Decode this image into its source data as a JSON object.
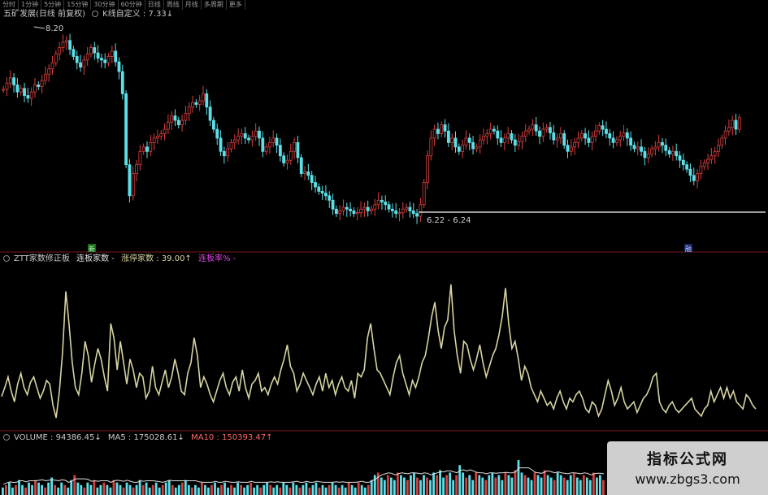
{
  "tabs": [
    "分时",
    "1分钟",
    "5分钟",
    "15分钟",
    "30分钟",
    "60分钟",
    "日线",
    "周线",
    "月线",
    "多周期",
    "更多"
  ],
  "main_header": {
    "title": "五矿发展(日线 前复权)",
    "indicator": "K线自定义 : 7.33↓"
  },
  "ztt_header": {
    "name": "ZTT家数修正板",
    "label1": "连板家数 -",
    "label2": "涨停家数 : 39.00↑",
    "label3": "连板率% -"
  },
  "vol_header": {
    "vol": "VOLUME : 94386.45↓",
    "ma5": "MA5 : 175028.61↓",
    "ma10": "MA10 : 150393.47↑"
  },
  "annotations": {
    "high_label": "8.20",
    "range_label": "6.22 - 6.24",
    "marker_left": "新",
    "marker_right": "融"
  },
  "watermark": {
    "title": "指标公式网",
    "url": "www.zbgs3.com"
  },
  "colors": {
    "up": "#d84040",
    "down": "#5ce0e8",
    "ztt_line": "#d8d4a0",
    "ma_line": "#e0e0e0",
    "label_blue": "#66ccff",
    "label_purple": "#dd44dd",
    "label_red": "#ff4444"
  },
  "chart_data": [
    {
      "type": "candlestick",
      "title": "五矿发展(日线 前复权)",
      "ylim": [
        6.0,
        8.4
      ],
      "closes": [
        7.65,
        7.72,
        7.78,
        7.7,
        7.62,
        7.66,
        7.58,
        7.55,
        7.62,
        7.7,
        7.68,
        7.75,
        7.82,
        7.88,
        7.95,
        8.05,
        8.12,
        8.18,
        8.2,
        8.1,
        8.02,
        7.95,
        7.9,
        7.98,
        8.05,
        8.12,
        8.06,
        8.0,
        7.98,
        7.95,
        8.02,
        8.08,
        7.96,
        7.85,
        7.6,
        6.8,
        6.45,
        6.7,
        6.8,
        6.95,
        7.0,
        6.95,
        7.05,
        7.1,
        7.12,
        7.15,
        7.2,
        7.28,
        7.35,
        7.3,
        7.25,
        7.3,
        7.38,
        7.45,
        7.5,
        7.48,
        7.52,
        7.6,
        7.45,
        7.3,
        7.2,
        7.1,
        6.95,
        6.9,
        6.98,
        7.05,
        7.08,
        7.12,
        7.15,
        7.1,
        7.08,
        7.12,
        7.18,
        7.1,
        6.95,
        7.0,
        7.05,
        7.1,
        7.02,
        6.9,
        6.82,
        6.85,
        6.95,
        7.05,
        6.88,
        6.7,
        6.72,
        6.68,
        6.6,
        6.55,
        6.5,
        6.48,
        6.45,
        6.4,
        6.3,
        6.25,
        6.28,
        6.32,
        6.3,
        6.28,
        6.25,
        6.26,
        6.3,
        6.32,
        6.28,
        6.3,
        6.35,
        6.4,
        6.38,
        6.35,
        6.3,
        6.28,
        6.25,
        6.26,
        6.3,
        6.32,
        6.28,
        6.25,
        6.22,
        6.35,
        6.6,
        6.9,
        7.1,
        7.2,
        7.15,
        7.25,
        7.18,
        7.05,
        7.1,
        7.0,
        6.95,
        7.02,
        7.1,
        7.05,
        6.98,
        7.0,
        7.08,
        7.12,
        7.15,
        7.2,
        7.18,
        7.1,
        7.05,
        7.1,
        7.15,
        7.08,
        7.02,
        7.06,
        7.12,
        7.18,
        7.2,
        7.25,
        7.18,
        7.12,
        7.2,
        7.22,
        7.16,
        7.08,
        7.1,
        7.15,
        7.02,
        6.95,
        7.0,
        7.05,
        7.1,
        7.15,
        7.1,
        7.05,
        7.12,
        7.18,
        7.24,
        7.2,
        7.15,
        7.1,
        7.05,
        7.08,
        7.12,
        7.16,
        7.1,
        7.02,
        6.98,
        7.0,
        6.95,
        6.88,
        6.92,
        6.98,
        7.0,
        7.05,
        7.02,
        6.96,
        6.92,
        6.95,
        6.9,
        6.85,
        6.8,
        6.75,
        6.68,
        6.62,
        6.7,
        6.78,
        6.82,
        6.86,
        6.9,
        6.95,
        7.02,
        7.1,
        7.18,
        7.22,
        7.3,
        7.2,
        7.33
      ]
    },
    {
      "type": "line",
      "name": "涨停家数",
      "values": [
        17,
        22,
        28,
        20,
        14,
        24,
        30,
        22,
        18,
        25,
        28,
        22,
        16,
        20,
        26,
        24,
        12,
        5,
        20,
        42,
        76,
        58,
        36,
        22,
        18,
        30,
        48,
        40,
        25,
        35,
        44,
        38,
        28,
        20,
        58,
        50,
        32,
        48,
        36,
        24,
        38,
        32,
        22,
        30,
        28,
        16,
        20,
        34,
        22,
        18,
        25,
        32,
        22,
        28,
        38,
        30,
        20,
        18,
        30,
        36,
        50,
        40,
        22,
        28,
        24,
        18,
        14,
        20,
        26,
        30,
        22,
        18,
        25,
        28,
        20,
        32,
        22,
        16,
        24,
        26,
        30,
        20,
        22,
        18,
        24,
        28,
        24,
        32,
        38,
        46,
        34,
        30,
        20,
        24,
        30,
        26,
        22,
        18,
        24,
        28,
        20,
        30,
        22,
        26,
        18,
        24,
        28,
        22,
        20,
        26,
        16,
        30,
        28,
        32,
        50,
        58,
        44,
        32,
        30,
        26,
        22,
        18,
        28,
        36,
        40,
        30,
        24,
        18,
        26,
        22,
        28,
        36,
        40,
        50,
        62,
        70,
        54,
        44,
        56,
        60,
        80,
        54,
        40,
        30,
        48,
        46,
        38,
        32,
        38,
        46,
        36,
        28,
        34,
        40,
        44,
        52,
        62,
        78,
        58,
        44,
        48,
        38,
        26,
        34,
        30,
        22,
        18,
        14,
        20,
        16,
        12,
        14,
        10,
        16,
        20,
        14,
        10,
        16,
        14,
        18,
        20,
        16,
        10,
        8,
        14,
        12,
        6,
        10,
        18,
        26,
        20,
        12,
        16,
        22,
        14,
        10,
        12,
        14,
        8,
        12,
        16,
        18,
        22,
        28,
        30,
        14,
        10,
        8,
        12,
        14,
        10,
        8,
        10,
        12,
        14,
        16,
        10,
        8,
        6,
        10,
        12,
        20,
        14,
        18,
        22,
        16,
        22,
        16,
        20,
        14,
        12,
        10,
        18,
        16,
        12,
        10
      ],
      "ylim": [
        0,
        90
      ]
    },
    {
      "type": "bar",
      "name": "VOLUME",
      "values": [
        3,
        4,
        5,
        3,
        4,
        6,
        4,
        3,
        5,
        4,
        6,
        5,
        4,
        3,
        5,
        7,
        4,
        3,
        5,
        4,
        3,
        6,
        8,
        5,
        4,
        3,
        5,
        4,
        6,
        3,
        4,
        5,
        4,
        3,
        6,
        5,
        4,
        3,
        5,
        4,
        3,
        4,
        6,
        4,
        5,
        3,
        4,
        5,
        3,
        4,
        5,
        6,
        4,
        3,
        4,
        5,
        6,
        4,
        3,
        4,
        3,
        5,
        4,
        3,
        4,
        5,
        3,
        4,
        5,
        3,
        4,
        3,
        5,
        4,
        3,
        4,
        5,
        3,
        4,
        3,
        4,
        5,
        4,
        3,
        4,
        3,
        5,
        4,
        3,
        5,
        4,
        3,
        4,
        5,
        3,
        4,
        5,
        3,
        4,
        3,
        4,
        5,
        4,
        3,
        4,
        3,
        5,
        4,
        3,
        5,
        4,
        3,
        4,
        6,
        8,
        9,
        7,
        6,
        8,
        7,
        6,
        9,
        8,
        7,
        6,
        8,
        9,
        7,
        6,
        8,
        7,
        6,
        9,
        8,
        10,
        7,
        8,
        9,
        6,
        8,
        12,
        9,
        7,
        8,
        6,
        9,
        8,
        7,
        6,
        8,
        9,
        7,
        8,
        6,
        9,
        8,
        7,
        10,
        14,
        9,
        8,
        7,
        6,
        9,
        8,
        7,
        10,
        8,
        7,
        6,
        9,
        8,
        7,
        6,
        8,
        9,
        7,
        6,
        8,
        7,
        6,
        9,
        7,
        8,
        6
      ],
      "ma5": 175028.61,
      "ma10": 150393.47
    }
  ]
}
